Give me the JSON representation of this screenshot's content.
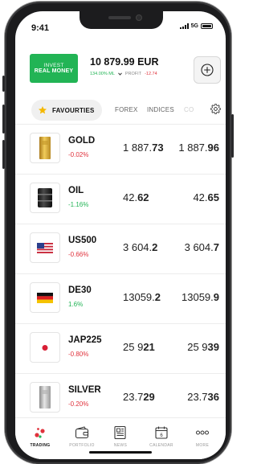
{
  "status": {
    "time": "9:41",
    "network": "5G"
  },
  "header": {
    "invest_line1": "INVEST",
    "invest_line2": "REAL MONEY",
    "balance": "10 879.99 EUR",
    "margin_pct": "134.00% ML",
    "profit_label": "PROFIT",
    "profit_value": "-12.74"
  },
  "tabs": {
    "favourites": "FAVOURTIES",
    "forex": "FOREX",
    "indices": "INDICES",
    "commodities_partial": "CO"
  },
  "instruments": [
    {
      "symbol": "GOLD",
      "change": "-0.02%",
      "trend": "neg",
      "bid_main": "1 887.",
      "bid_bold": "73",
      "ask_main": "1 887.",
      "ask_bold": "96",
      "icon": "gold-bar-icon"
    },
    {
      "symbol": "OIL",
      "change": "-1.16%",
      "trend": "pos",
      "bid_main": "42.",
      "bid_bold": "62",
      "ask_main": "42.",
      "ask_bold": "65",
      "icon": "oil-barrel-icon"
    },
    {
      "symbol": "US500",
      "change": "-0.66%",
      "trend": "neg",
      "bid_main": "3 604.",
      "bid_bold": "2",
      "ask_main": "3 604.",
      "ask_bold": "7",
      "icon": "us-flag-icon"
    },
    {
      "symbol": "DE30",
      "change": "1.6%",
      "trend": "pos",
      "bid_main": "13059.",
      "bid_bold": "2",
      "ask_main": "13059.",
      "ask_bold": "9",
      "icon": "germany-flag-icon"
    },
    {
      "symbol": "JAP225",
      "change": "-0.80%",
      "trend": "neg",
      "bid_main": "25 9",
      "bid_bold": "21",
      "ask_main": "25 9",
      "ask_bold": "39",
      "icon": "japan-flag-icon"
    },
    {
      "symbol": "SILVER",
      "change": "-0.20%",
      "trend": "neg",
      "bid_main": "23.7",
      "bid_bold": "29",
      "ask_main": "23.7",
      "ask_bold": "36",
      "icon": "silver-bar-icon"
    }
  ],
  "nav": {
    "trading": "TRADING",
    "portfolio": "PORTFOLIO",
    "news": "NEWS",
    "calendar": "CALENDAR",
    "calendar_day": "6",
    "more": "MORE"
  },
  "colors": {
    "accent_green": "#22b455",
    "negative_red": "#e0323c"
  }
}
